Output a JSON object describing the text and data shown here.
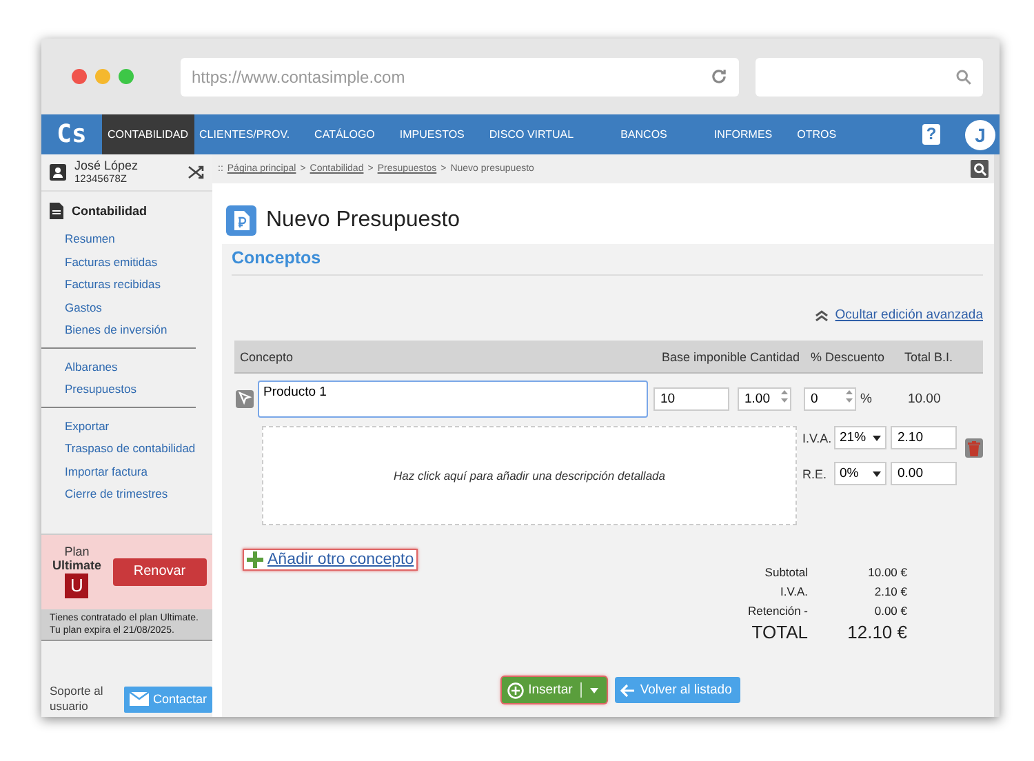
{
  "browser": {
    "url": "https://www.contasimple.com"
  },
  "nav": {
    "logo": "Cs",
    "items": [
      {
        "label": "CONTABILIDAD",
        "selected": true
      },
      {
        "label": "CLIENTES/PROV.",
        "selected": false
      },
      {
        "label": "CATÁLOGO",
        "selected": false
      },
      {
        "label": "IMPUESTOS",
        "selected": false
      },
      {
        "label": "DISCO VIRTUAL",
        "selected": false
      },
      {
        "label": "BANCOS",
        "selected": false
      },
      {
        "label": "INFORMES",
        "selected": false
      },
      {
        "label": "OTROS",
        "selected": false
      }
    ],
    "help": "?",
    "avatar": "J"
  },
  "sidebar": {
    "user": {
      "name": "José López",
      "id": "12345678Z"
    },
    "section": "Contabilidad",
    "groups": [
      [
        "Resumen",
        "Facturas emitidas",
        "Facturas recibidas",
        "Gastos",
        "Bienes de inversión"
      ],
      [
        "Albaranes",
        "Presupuestos"
      ],
      [
        "Exportar",
        "Traspaso de contabilidad",
        "Importar factura",
        "Cierre de trimestres"
      ]
    ],
    "plan": {
      "label": "Plan",
      "name": "Ultimate",
      "badge": "U",
      "button": "Renovar",
      "notice": [
        "Tienes contratado el plan Ultimate.",
        "Tu plan expira el 21/08/2025."
      ]
    },
    "support": {
      "label": "Soporte al usuario",
      "button": "Contactar"
    }
  },
  "breadcrumb": {
    "prefix": "::",
    "separator": ">",
    "items": [
      {
        "label": "Página principal",
        "link": true
      },
      {
        "label": "Contabilidad",
        "link": true
      },
      {
        "label": "Presupuestos",
        "link": true
      },
      {
        "label": "Nuevo presupuesto",
        "link": false
      }
    ]
  },
  "page": {
    "title": "Nuevo Presupuesto",
    "section": "Conceptos",
    "toggle_link": "Ocultar edición avanzada",
    "columns": [
      "Concepto",
      "Base imponible",
      "Cantidad",
      "% Descuento",
      "Total B.I."
    ],
    "row": {
      "concept": "Producto 1",
      "base": "10",
      "quantity": "1.00",
      "discount": "0",
      "percent": "%",
      "total": "10.00",
      "description_hint": "Haz click aquí para añadir una descripción detallada",
      "iva_label": "I.V.A.",
      "iva_rate": "21%",
      "iva_amount": "2.10",
      "re_label": "R.E.",
      "re_rate": "0%",
      "re_amount": "0.00"
    },
    "add_link": "Añadir otro concepto",
    "totals": [
      {
        "label": "Subtotal",
        "value": "10.00 €",
        "kind": "line"
      },
      {
        "label": "I.V.A.",
        "value": "2.10 €",
        "kind": "line"
      },
      {
        "label": "Retención -",
        "value": "0.00 €",
        "kind": "line"
      },
      {
        "label": "TOTAL",
        "value": "12.10 €",
        "kind": "grand"
      }
    ],
    "buttons": {
      "insert": "Insertar",
      "back": "Volver al listado"
    }
  }
}
